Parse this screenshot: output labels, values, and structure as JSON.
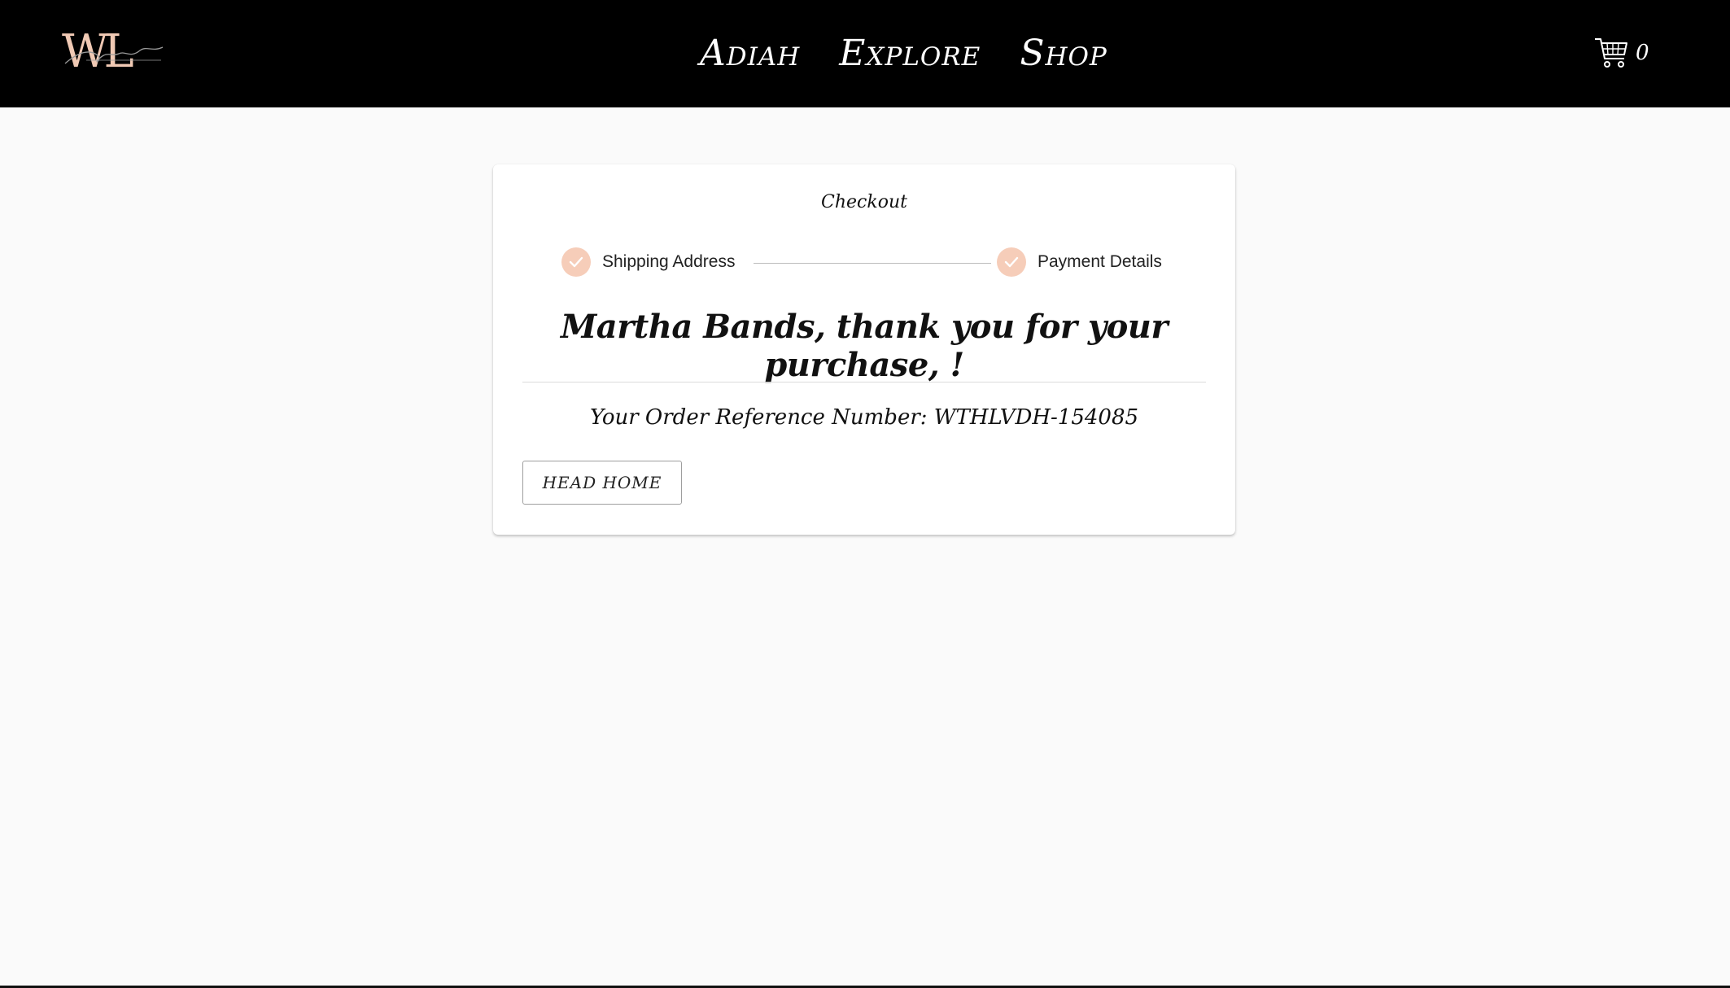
{
  "header": {
    "logo_text": "WL",
    "logo_signature": "Adiah",
    "nav": [
      "Adiah",
      "Explore",
      "Shop"
    ],
    "cart_count": "0",
    "cart_icon": "shopping-cart-icon",
    "background": "#000000",
    "logo_color": "#f0c9b4"
  },
  "checkout": {
    "title": "Checkout",
    "steps": [
      {
        "label": "Shipping Address",
        "completed": true,
        "icon": "check-icon"
      },
      {
        "label": "Payment Details",
        "completed": true,
        "icon": "check-icon"
      }
    ],
    "step_color": "#f6cdb9",
    "thank_you": "Martha Bands, thank you for your purchase, !",
    "order_reference": "Your Order Reference Number: WTHLVDH-154085",
    "home_button_label": "HEAD HOME"
  }
}
